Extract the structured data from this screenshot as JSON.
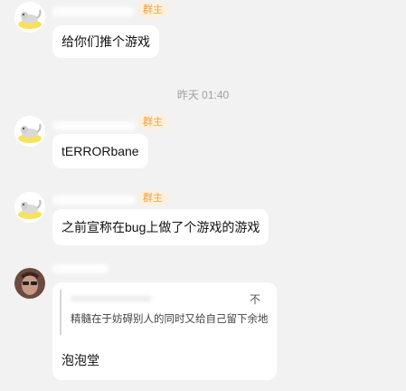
{
  "messages": [
    {
      "badge": "群主",
      "text": "给你们推个游戏"
    },
    {
      "badge": "群主",
      "text": "tERRORbane"
    },
    {
      "badge": "群主",
      "text": "之前宣称在bug上做了个游戏的游戏"
    },
    {
      "quote": {
        "mark": "不",
        "text": "精髓在于妨碍别人的同时又给自己留下余地"
      },
      "text": "泡泡堂"
    }
  ],
  "timestamp": "昨天 01:40",
  "colors": {
    "background": "#f2f2f2",
    "bubble": "#ffffff",
    "badge_text": "#f2a13c",
    "badge_bg": "#fdf0dc"
  }
}
